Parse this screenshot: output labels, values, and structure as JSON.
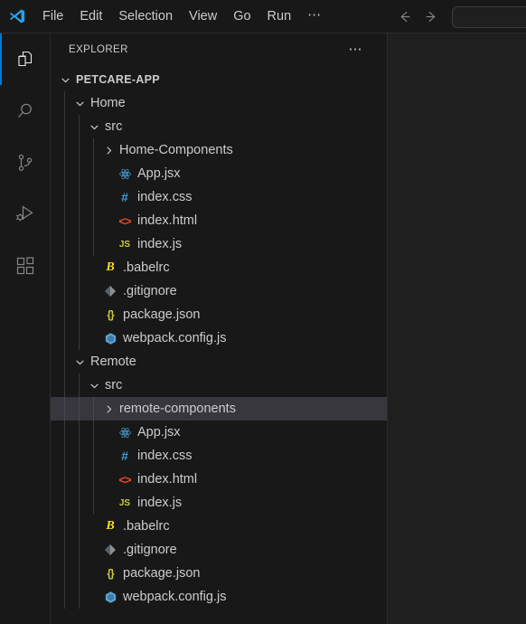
{
  "titlebar": {
    "logo_icon": "vscode-logo-icon",
    "menus": [
      "File",
      "Edit",
      "Selection",
      "View",
      "Go",
      "Run"
    ],
    "more_label": "⋯",
    "back_icon": "arrow-left-icon",
    "forward_icon": "arrow-right-icon",
    "command_center_value": ""
  },
  "activitybar": {
    "items": [
      {
        "name": "explorer",
        "icon": "files-icon",
        "active": true
      },
      {
        "name": "search",
        "icon": "search-icon",
        "active": false
      },
      {
        "name": "source-control",
        "icon": "source-control-icon",
        "active": false
      },
      {
        "name": "run-and-debug",
        "icon": "run-debug-icon",
        "active": false
      },
      {
        "name": "extensions",
        "icon": "extensions-icon",
        "active": false
      }
    ]
  },
  "sidebar": {
    "title": "EXPLORER",
    "actions_label": "⋯",
    "tree": [
      {
        "label": "PETCARE-APP",
        "depth": 0,
        "kind": "root",
        "state": "expanded",
        "icon": "chevron-down-icon",
        "selected": false
      },
      {
        "label": "Home",
        "depth": 1,
        "kind": "folder",
        "state": "expanded",
        "icon": "chevron-down-icon",
        "selected": false
      },
      {
        "label": "src",
        "depth": 2,
        "kind": "folder",
        "state": "expanded",
        "icon": "chevron-down-icon",
        "selected": false
      },
      {
        "label": "Home-Components",
        "depth": 3,
        "kind": "folder",
        "state": "collapsed",
        "icon": "chevron-right-icon",
        "selected": false
      },
      {
        "label": "App.jsx",
        "depth": 3,
        "kind": "file",
        "icon": "react-icon",
        "selected": false
      },
      {
        "label": "index.css",
        "depth": 3,
        "kind": "file",
        "icon": "css-icon",
        "selected": false
      },
      {
        "label": "index.html",
        "depth": 3,
        "kind": "file",
        "icon": "html-icon",
        "selected": false
      },
      {
        "label": "index.js",
        "depth": 3,
        "kind": "file",
        "icon": "js-icon",
        "selected": false
      },
      {
        "label": ".babelrc",
        "depth": 2,
        "kind": "file",
        "icon": "babel-icon",
        "selected": false
      },
      {
        "label": ".gitignore",
        "depth": 2,
        "kind": "file",
        "icon": "git-icon",
        "selected": false
      },
      {
        "label": "package.json",
        "depth": 2,
        "kind": "file",
        "icon": "json-icon",
        "selected": false
      },
      {
        "label": "webpack.config.js",
        "depth": 2,
        "kind": "file",
        "icon": "webpack-icon",
        "selected": false
      },
      {
        "label": "Remote",
        "depth": 1,
        "kind": "folder",
        "state": "expanded",
        "icon": "chevron-down-icon",
        "selected": false
      },
      {
        "label": "src",
        "depth": 2,
        "kind": "folder",
        "state": "expanded",
        "icon": "chevron-down-icon",
        "selected": false
      },
      {
        "label": "remote-components",
        "depth": 3,
        "kind": "folder",
        "state": "collapsed",
        "icon": "chevron-right-icon",
        "selected": true
      },
      {
        "label": "App.jsx",
        "depth": 3,
        "kind": "file",
        "icon": "react-icon",
        "selected": false
      },
      {
        "label": "index.css",
        "depth": 3,
        "kind": "file",
        "icon": "css-icon",
        "selected": false
      },
      {
        "label": "index.html",
        "depth": 3,
        "kind": "file",
        "icon": "html-icon",
        "selected": false
      },
      {
        "label": "index.js",
        "depth": 3,
        "kind": "file",
        "icon": "js-icon",
        "selected": false
      },
      {
        "label": ".babelrc",
        "depth": 2,
        "kind": "file",
        "icon": "babel-icon",
        "selected": false
      },
      {
        "label": ".gitignore",
        "depth": 2,
        "kind": "file",
        "icon": "git-icon",
        "selected": false
      },
      {
        "label": "package.json",
        "depth": 2,
        "kind": "file",
        "icon": "json-icon",
        "selected": false
      },
      {
        "label": "webpack.config.js",
        "depth": 2,
        "kind": "file",
        "icon": "webpack-icon",
        "selected": false
      }
    ]
  },
  "colors": {
    "titlebar_bg": "#181818",
    "sidebar_bg": "#181818",
    "editor_bg": "#1f1f1f",
    "selected_row_bg": "#37373d",
    "active_indicator": "#0078d4",
    "foreground": "#cccccc",
    "react_blue": "#4d9fd0",
    "css_blue": "#3c9cd8",
    "html_orange": "#e44d26",
    "js_yellow": "#cbcb41",
    "babel_yellow": "#f5de19",
    "git_grey": "#8b9196",
    "json_yellow": "#cbcb41",
    "webpack_blue": "#4b91c4"
  }
}
